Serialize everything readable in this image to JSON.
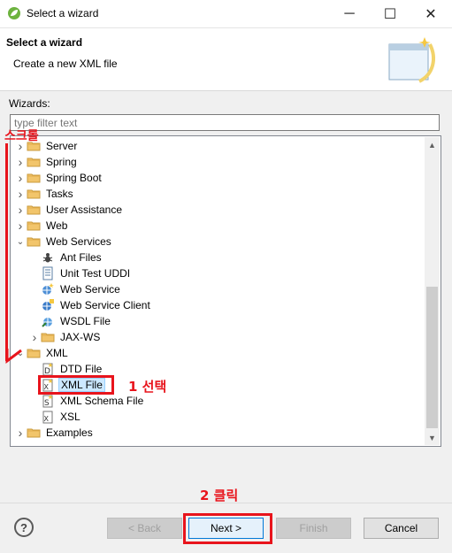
{
  "window": {
    "title": "Select a wizard",
    "app_icon": "spring-leaf-icon",
    "controls": {
      "minimize": "─",
      "maximize": "☐",
      "close": "✕"
    }
  },
  "header": {
    "title": "Select a wizard",
    "description": "Create a new XML file",
    "banner_icon": "wizard-banner-icon"
  },
  "wizards": {
    "label": "Wizards:",
    "filter_placeholder": "type filter text",
    "tree": [
      {
        "label": "Server",
        "level": 0,
        "expanded": false,
        "icon": "folder-icon"
      },
      {
        "label": "Spring",
        "level": 0,
        "expanded": false,
        "icon": "folder-icon"
      },
      {
        "label": "Spring Boot",
        "level": 0,
        "expanded": false,
        "icon": "folder-icon"
      },
      {
        "label": "Tasks",
        "level": 0,
        "expanded": false,
        "icon": "folder-icon"
      },
      {
        "label": "User Assistance",
        "level": 0,
        "expanded": false,
        "icon": "folder-icon"
      },
      {
        "label": "Web",
        "level": 0,
        "expanded": false,
        "icon": "folder-icon"
      },
      {
        "label": "Web Services",
        "level": 0,
        "expanded": true,
        "icon": "folder-icon"
      },
      {
        "label": "Ant Files",
        "level": 1,
        "icon": "ant-icon"
      },
      {
        "label": "Unit Test UDDI",
        "level": 1,
        "icon": "document-icon"
      },
      {
        "label": "Web Service",
        "level": 1,
        "icon": "web-service-icon"
      },
      {
        "label": "Web Service Client",
        "level": 1,
        "icon": "web-service-client-icon"
      },
      {
        "label": "WSDL File",
        "level": 1,
        "icon": "wsdl-icon"
      },
      {
        "label": "JAX-WS",
        "level": 1,
        "expanded": false,
        "icon": "folder-icon"
      },
      {
        "label": "XML",
        "level": 0,
        "expanded": true,
        "icon": "folder-icon"
      },
      {
        "label": "DTD File",
        "level": 1,
        "icon": "dtd-icon"
      },
      {
        "label": "XML File",
        "level": 1,
        "icon": "xml-file-icon",
        "selected": true
      },
      {
        "label": "XML Schema File",
        "level": 1,
        "icon": "xsd-icon"
      },
      {
        "label": "XSL",
        "level": 1,
        "icon": "xsl-icon"
      },
      {
        "label": "Examples",
        "level": 0,
        "expanded": false,
        "icon": "folder-icon"
      }
    ]
  },
  "buttons": {
    "back": "< Back",
    "next": "Next >",
    "finish": "Finish",
    "cancel": "Cancel",
    "help": "?"
  },
  "annotations": {
    "scroll_note": "스크롤",
    "select_note": "1 선택",
    "click_note": "2 클릭",
    "color": "#e8141c"
  }
}
